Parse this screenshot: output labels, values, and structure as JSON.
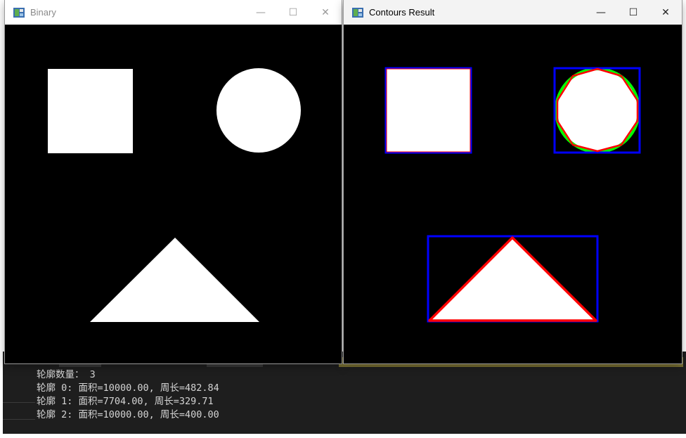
{
  "windows": {
    "binary": {
      "title": "Binary"
    },
    "contours": {
      "title": "Contours Result"
    }
  },
  "window_controls": {
    "minimize": "—",
    "maximize": "☐",
    "close": "✕"
  },
  "terminal": {
    "lines": [
      "轮廓数量： 3",
      "轮廓 0: 面积=10000.00, 周长=482.84",
      "轮廓 1: 面积=7704.00, 周长=329.71",
      "轮廓 2: 面积=10000.00, 周长=400.00"
    ]
  },
  "colors": {
    "bounding_box": "#0000ff",
    "approx_polygon": "#ff0000",
    "enclosing_circle": "#00ff00",
    "shape_fill": "#ffffff",
    "background": "#000000",
    "terminal_bg": "#1e1e1e"
  },
  "icons": {
    "app": "window-app-icon"
  }
}
